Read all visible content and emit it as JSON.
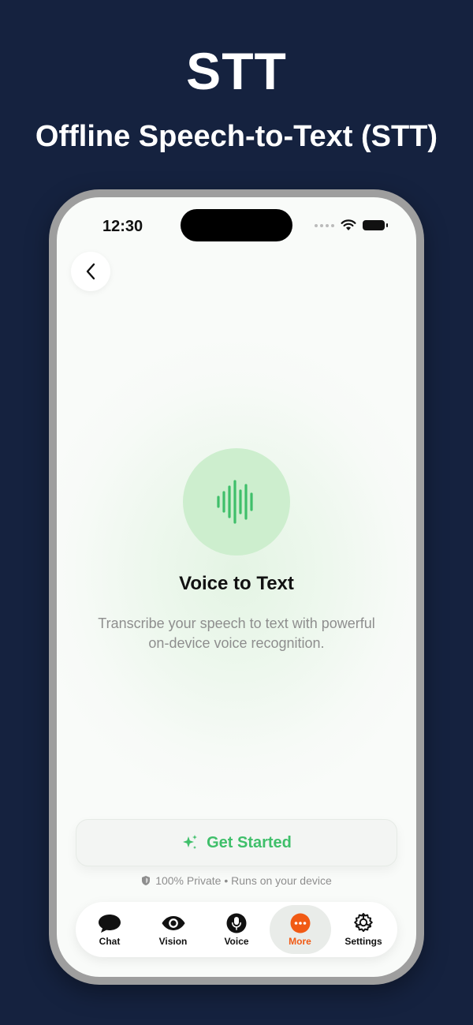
{
  "promo": {
    "title": "STT",
    "subtitle": "Offline Speech-to-Text (STT)"
  },
  "status_bar": {
    "time": "12:30"
  },
  "hero": {
    "icon": "waveform-icon",
    "title": "Voice to Text",
    "description": "Transcribe your speech to text with powerful on-device voice recognition."
  },
  "cta": {
    "icon": "sparkle-icon",
    "label": "Get Started"
  },
  "privacy": {
    "icon": "shield-icon",
    "text": "100% Private • Runs on your device"
  },
  "tabs": [
    {
      "label": "Chat",
      "icon": "chat-bubble-icon",
      "active": false
    },
    {
      "label": "Vision",
      "icon": "eye-icon",
      "active": false
    },
    {
      "label": "Voice",
      "icon": "microphone-icon",
      "active": false
    },
    {
      "label": "More",
      "icon": "more-icon",
      "active": true
    },
    {
      "label": "Settings",
      "icon": "gear-icon",
      "active": false
    }
  ],
  "colors": {
    "background": "#15223f",
    "accent_green": "#3fbf6a",
    "accent_orange": "#f15a14",
    "hero_circle": "#cdeece"
  }
}
